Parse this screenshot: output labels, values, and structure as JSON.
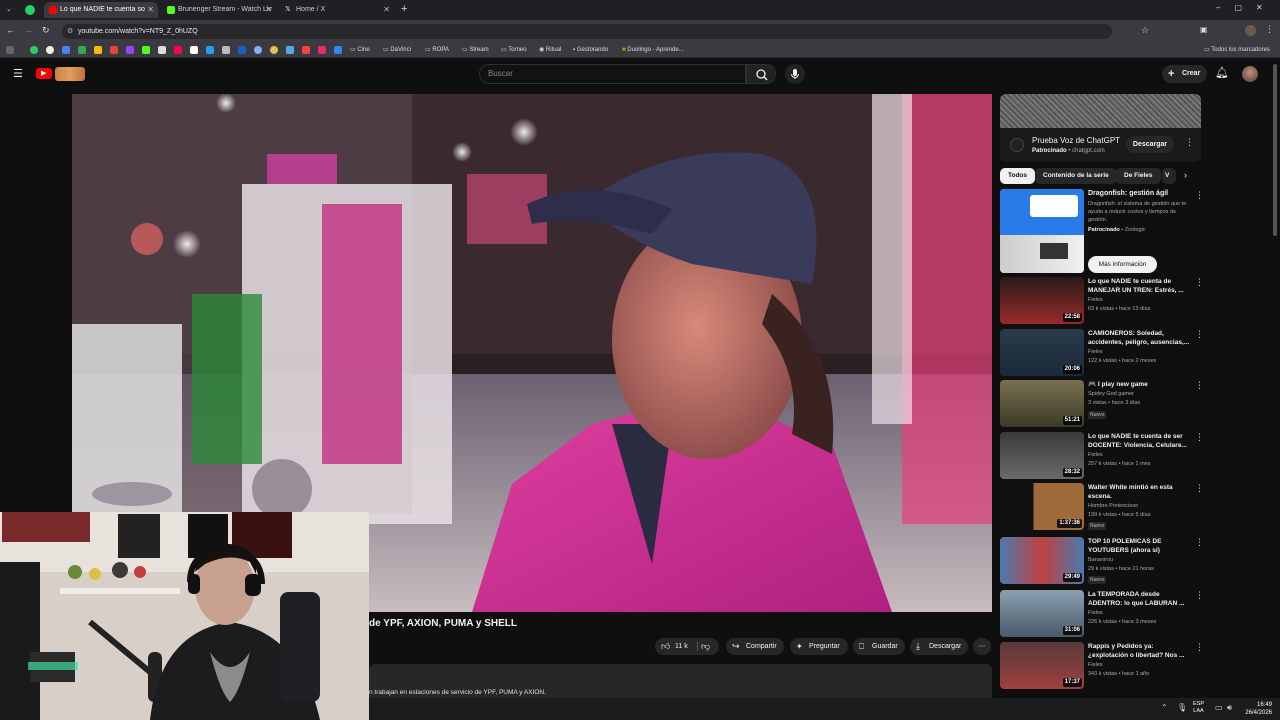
{
  "browser": {
    "tabs": [
      {
        "title": "Lo que NADIE te cuenta so",
        "color": "#ff0000"
      },
      {
        "title": "Brunenger Stream - Watch Liv",
        "color": "#53fc18"
      },
      {
        "title": "Home / X",
        "color": "#ffffff"
      }
    ],
    "url": "youtube.com/watch?v=NT9_Z_0hUZQ",
    "bookmarks": [
      "Cine",
      "DaVinci",
      "ROPA",
      "Stream",
      "Torneo",
      "Ritual",
      "Gestorando",
      "Duolingo - Aprende..."
    ],
    "all_bookmarks": "Todos los marcadores"
  },
  "youtube": {
    "search_placeholder": "Buscar",
    "create_label": "Crear"
  },
  "video": {
    "title": "de YPF, AXION, PUMA y SHELL",
    "likes": "11 k",
    "share_label": "Compartir",
    "ask_label": "Preguntar",
    "save_label": "Guardar",
    "download_label": "Descargar",
    "description": "n trabajan en estaciones de servicio de YPF, PUMA y AXION."
  },
  "ad": {
    "title": "Prueba Voz de ChatGPT",
    "sponsor": "Patrocinado",
    "domain": "chatgpt.com",
    "button": "Descargar"
  },
  "chips": [
    "Todos",
    "Contenido de la serie",
    "De Fieles",
    "V"
  ],
  "promo": {
    "title": "Dragonfish: gestión ágil",
    "text": "Dragonfish: el sistema de gestión que te ayuda a reducir costos y tiempos de gestión.",
    "sponsor": "Patrocinado",
    "advertiser": "Zoologic",
    "cta": "Más información"
  },
  "recommendations": [
    {
      "title": "Lo que NADIE te cuenta de MANEJAR UN TREN: Estrés, ...",
      "channel": "Fieles",
      "meta": "63 k vistas • hace 13 días",
      "duration": "22:58",
      "badge": "",
      "thumb": "#7a2222"
    },
    {
      "title": "CAMIONEROS: Soledad, accidentes, peligro, ausencias,...",
      "channel": "Fieles",
      "meta": "122 k vistas • hace 2 meses",
      "duration": "20:06",
      "badge": "",
      "thumb": "#2b3a4a"
    },
    {
      "title": "🎮 I play new game",
      "channel": "Spidey God gamer",
      "meta": "3 vistas • hace 3 días",
      "duration": "51:21",
      "badge": "Nuevo",
      "thumb": "#5a5540"
    },
    {
      "title": "Lo que NADIE te cuenta de ser DOCENTE: Violencia, Celulare...",
      "channel": "Fieles",
      "meta": "257 k vistas • hace 1 mes",
      "duration": "28:32",
      "badge": "",
      "thumb": "#4a4a4a"
    },
    {
      "title": "Walter White mintió en esta escena.",
      "channel": "Hombre Pretencioso",
      "meta": "199 k vistas • hace 5 días",
      "duration": "1:37:36",
      "badge": "Nuevo",
      "thumb": "#6a4a2a"
    },
    {
      "title": "TOP 10 POLEMICAS DE YOUTUBERS (ahora sí)",
      "channel": "Bananirou",
      "meta": "29 k vistas • hace 21 horas",
      "duration": "29:49",
      "badge": "Nuevo",
      "thumb": "#3a6aa0"
    },
    {
      "title": "La TEMPORADA desde ADENTRO: lo que LABURAN ...",
      "channel": "Fieles",
      "meta": "226 k vistas • hace 3 meses",
      "duration": "31:06",
      "badge": "",
      "thumb": "#5a6a7a"
    },
    {
      "title": "Rappis y Pedidos ya: ¿explotación o libertad? Nos ...",
      "channel": "Fieles",
      "meta": "343 k vistas • hace 1 año",
      "duration": "17:37",
      "badge": "",
      "thumb": "#7a3030"
    }
  ],
  "taskbar": {
    "lang": "ESP",
    "region": "LAA",
    "time": "16:49",
    "date": "26/4/2026"
  }
}
